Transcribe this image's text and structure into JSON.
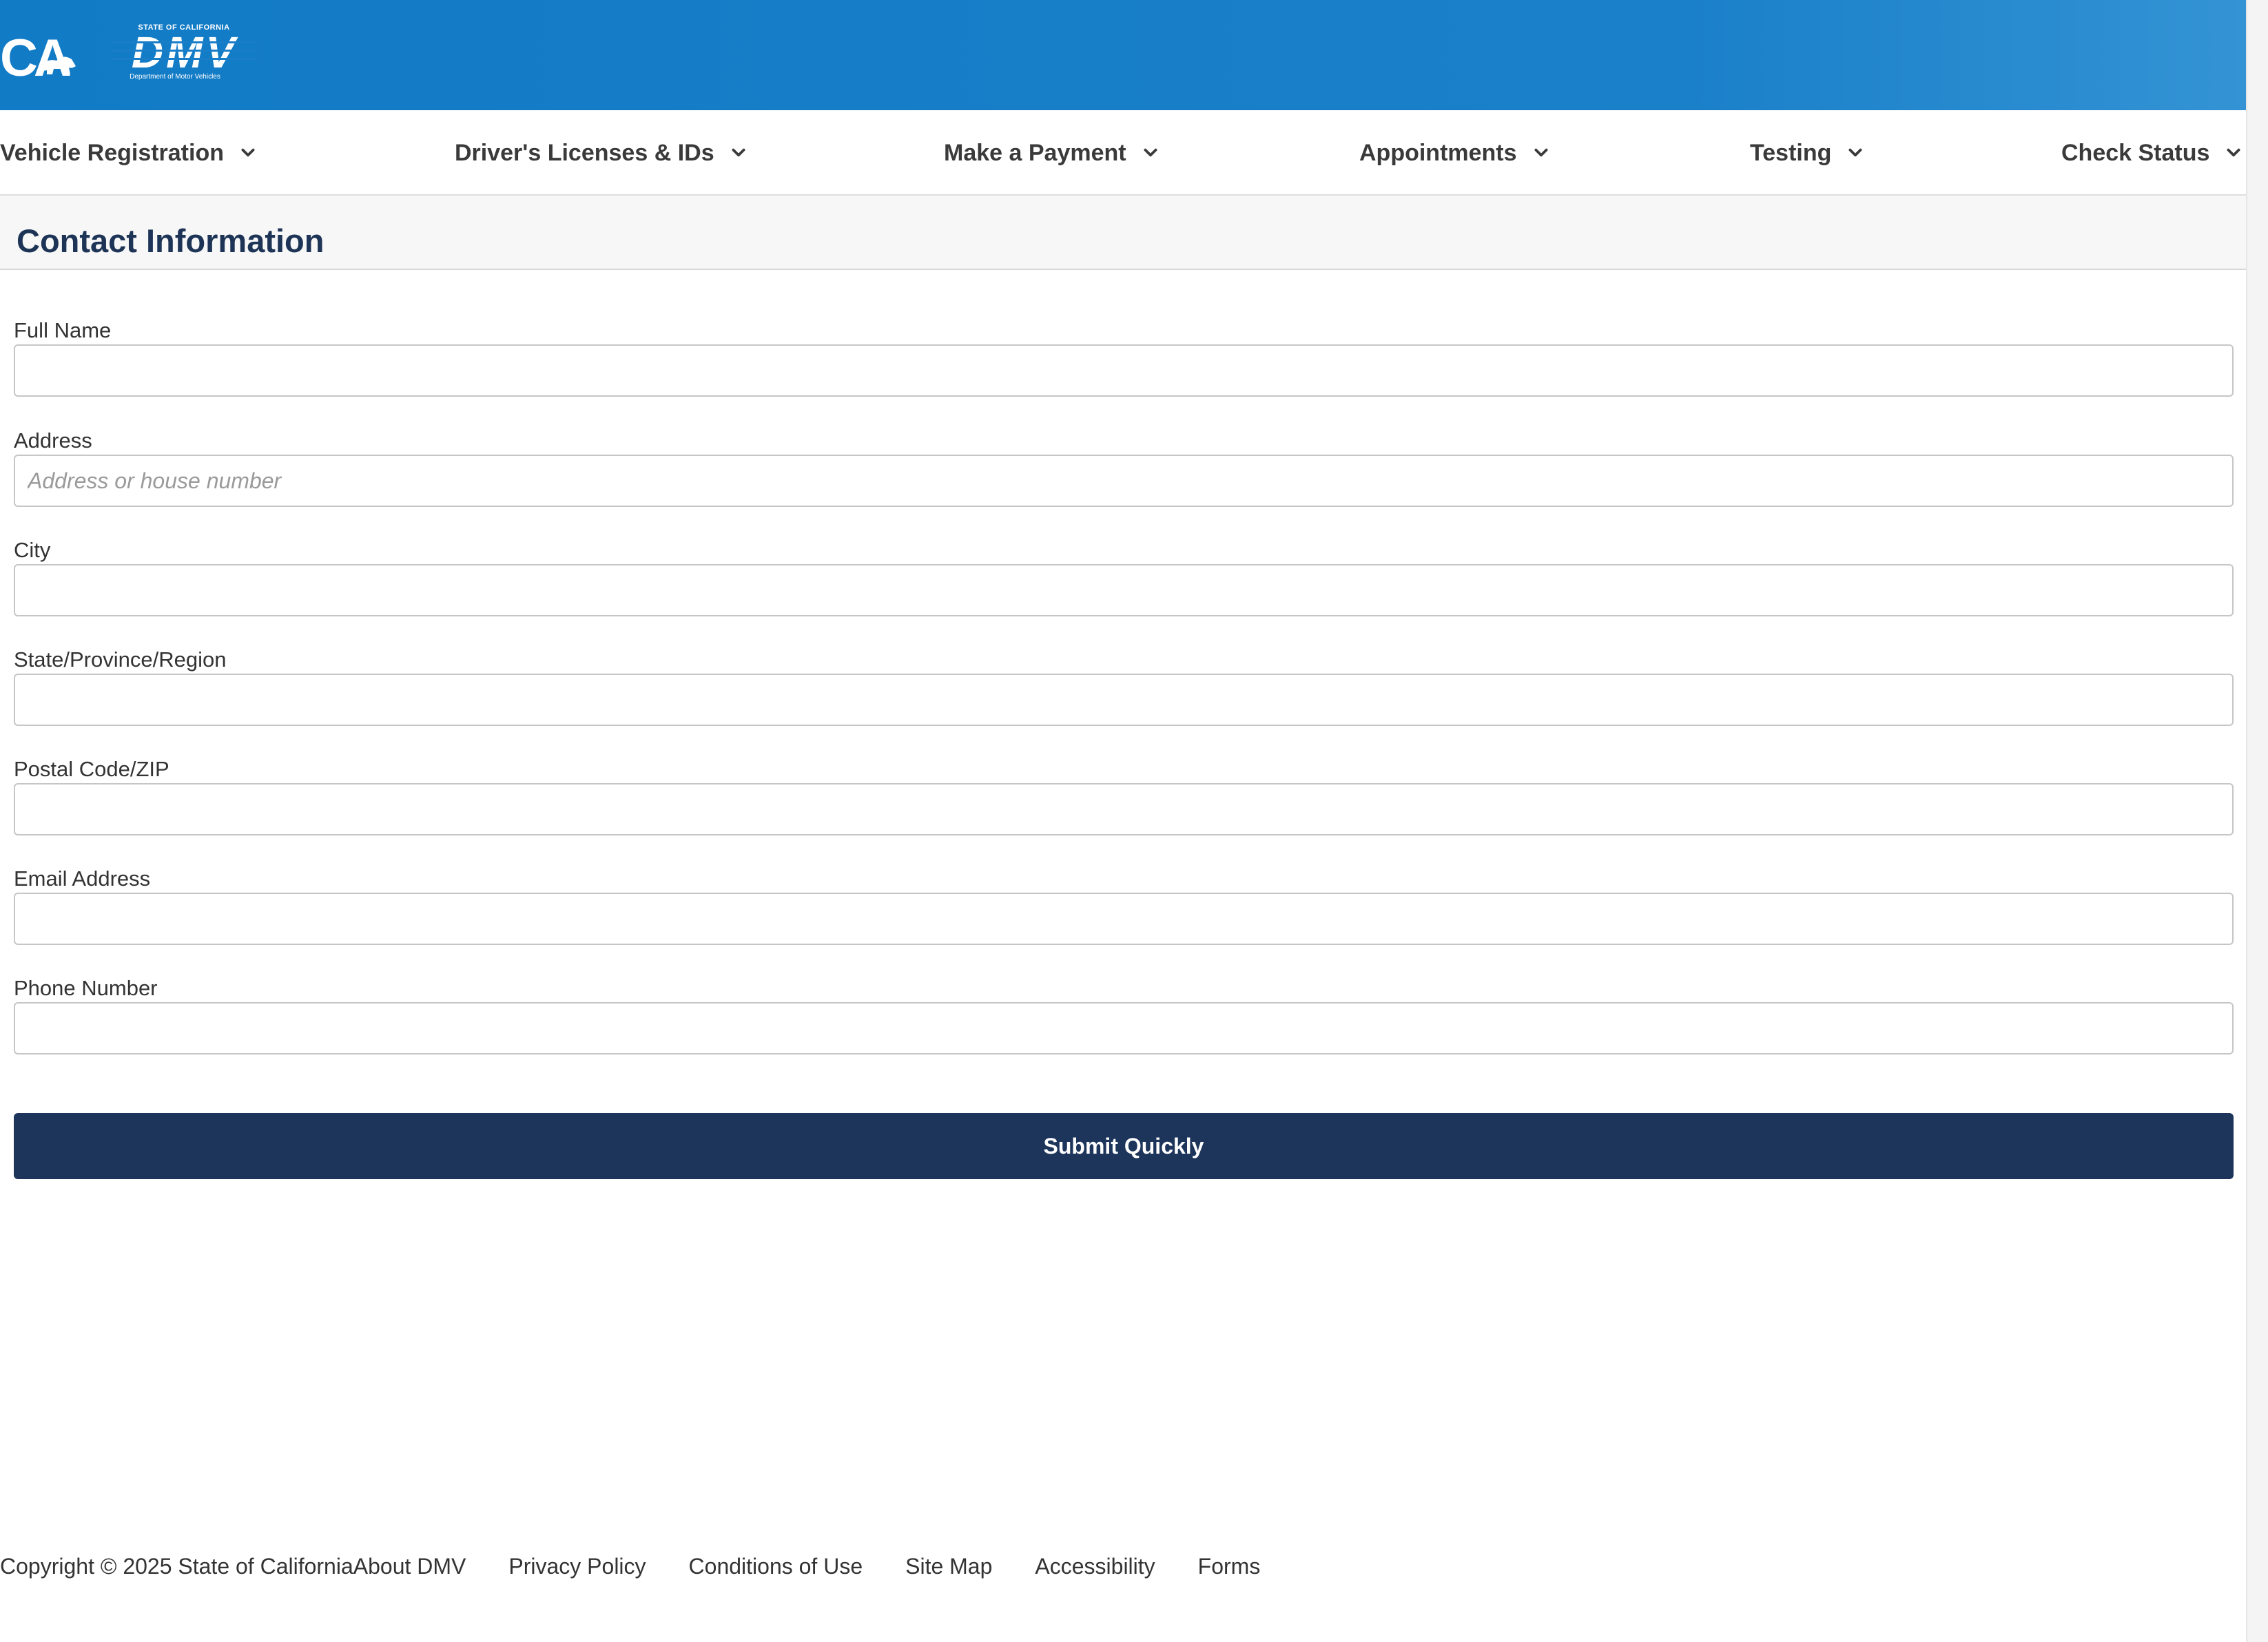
{
  "header": {
    "ca_logo_text": "CA",
    "dmv_top_text": "STATE OF CALIFORNIA",
    "dmv_word": "DMV",
    "dmv_sub_text": "Department of Motor Vehicles",
    "background_color": "#127bc6"
  },
  "nav": {
    "items": [
      {
        "label": "Vehicle Registration"
      },
      {
        "label": "Driver's Licenses & IDs"
      },
      {
        "label": "Make a Payment"
      },
      {
        "label": "Appointments"
      },
      {
        "label": "Testing"
      },
      {
        "label": "Check Status"
      }
    ],
    "chevron_icon": "chevron-down-icon"
  },
  "section": {
    "title": "Contact Information"
  },
  "form": {
    "fields": [
      {
        "label": "Full Name",
        "value": "",
        "placeholder": ""
      },
      {
        "label": "Address",
        "value": "",
        "placeholder": "Address or house number"
      },
      {
        "label": "City",
        "value": "",
        "placeholder": ""
      },
      {
        "label": "State/Province/Region",
        "value": "",
        "placeholder": ""
      },
      {
        "label": "Postal Code/ZIP",
        "value": "",
        "placeholder": ""
      },
      {
        "label": "Email Address",
        "value": "",
        "placeholder": ""
      },
      {
        "label": "Phone Number",
        "value": "",
        "placeholder": ""
      }
    ],
    "submit_label": "Submit Quickly",
    "submit_color": "#1d355b"
  },
  "footer": {
    "copyright": "Copyright © 2025 State of California",
    "links": [
      "About DMV",
      "Privacy Policy",
      "Conditions of Use",
      "Site Map",
      "Accessibility",
      "Forms"
    ]
  }
}
